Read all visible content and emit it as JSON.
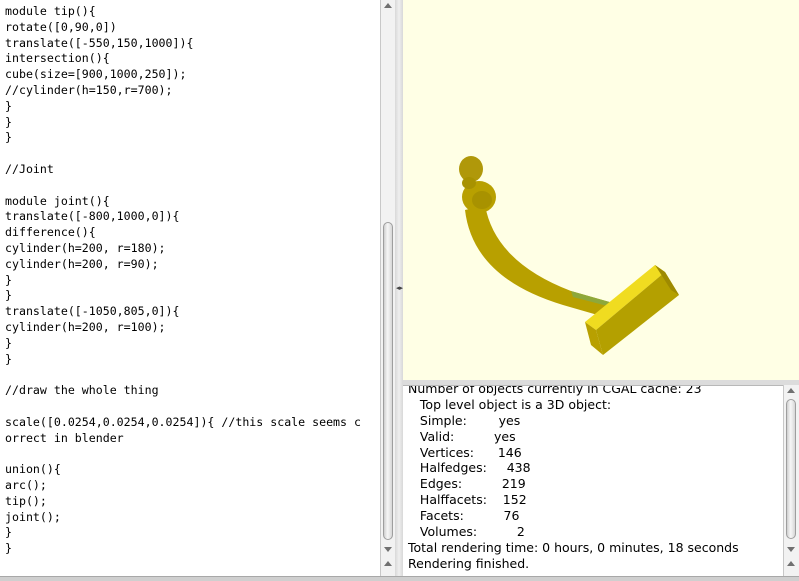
{
  "editor": {
    "code_lines": [
      "module tip(){",
      "rotate([0,90,0])",
      "translate([-550,150,1000]){",
      "intersection(){",
      "cube(size=[900,1000,250]);",
      "//cylinder(h=150,r=700);",
      "}",
      "}",
      "}",
      "",
      "//Joint",
      "",
      "module joint(){",
      "translate([-800,1000,0]){",
      "difference(){",
      "cylinder(h=200, r=180);",
      "cylinder(h=200, r=90);",
      "}",
      "}",
      "translate([-1050,805,0]){",
      "cylinder(h=200, r=100);",
      "}",
      "}",
      "",
      "//draw the whole thing",
      "",
      "scale([0.0254,0.0254,0.0254]){ //this scale seems c",
      "orrect in blender",
      "",
      "union(){",
      "arc();",
      "tip();",
      "joint();",
      "}",
      "}"
    ]
  },
  "viewport": {
    "background": "#ffffe5",
    "model_colors": {
      "face": "#b8a000",
      "highlight": "#f0dc20",
      "shade": "#9e8a00",
      "seam": "#8ea83a"
    }
  },
  "console": {
    "lines": [
      "Number of objects currently in CGAL cache: 23",
      "   Top level object is a 3D object:",
      "   Simple:        yes",
      "   Valid:          yes",
      "   Vertices:      146",
      "   Halfedges:     438",
      "   Edges:          219",
      "   Halffacets:    152",
      "   Facets:          76",
      "   Volumes:          2",
      "Total rendering time: 0 hours, 0 minutes, 18 seconds",
      "Rendering finished."
    ]
  }
}
